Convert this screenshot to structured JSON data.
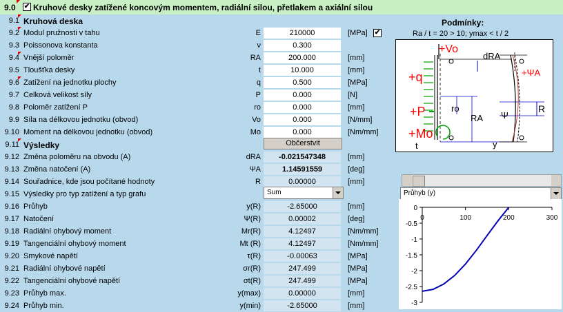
{
  "header": {
    "num": "9.0",
    "title": "Kruhové desky zatížené koncovým momentem, radiální silou, přetlakem a axiální silou",
    "checked": "✔"
  },
  "rows": [
    {
      "n": "9.1",
      "label": "Kruhová deska",
      "sym": "",
      "val": "",
      "unit": ""
    },
    {
      "n": "9.2",
      "label": "Modul pružnosti v tahu",
      "sym": "E",
      "val": "210000",
      "unit": "[MPa]"
    },
    {
      "n": "9.3",
      "label": "Poissonova konstanta",
      "sym": "ν",
      "val": "0.300",
      "unit": ""
    },
    {
      "n": "9.4",
      "label": "Vnější poloměr",
      "sym": "RA",
      "val": "200.000",
      "unit": "[mm]"
    },
    {
      "n": "9.5",
      "label": "Tloušťka desky",
      "sym": "t",
      "val": "10.000",
      "unit": "[mm]"
    },
    {
      "n": "9.6",
      "label": "Zatížení na jednotku plochy",
      "sym": "q",
      "val": "0.500",
      "unit": "[MPa]"
    },
    {
      "n": "9.7",
      "label": "Celková velikost síly",
      "sym": "P",
      "val": "0.000",
      "unit": "[N]"
    },
    {
      "n": "9.8",
      "label": "Poloměr zatížení P",
      "sym": "ro",
      "val": "0.000",
      "unit": "[mm]"
    },
    {
      "n": "9.9",
      "label": "Síla na délkovou jednotku (obvod)",
      "sym": "Vo",
      "val": "0.000",
      "unit": "[N/mm]"
    },
    {
      "n": "9.10",
      "label": "Moment na délkovou jednotku (obvod)",
      "sym": "Mo",
      "val": "0.000",
      "unit": "[Nm/mm]"
    },
    {
      "n": "9.11",
      "label": "Výsledky",
      "sym": "",
      "val": "",
      "unit": ""
    },
    {
      "n": "9.12",
      "label": "Změna poloměru na obvodu (A)",
      "sym": "dRA",
      "val": "-0.021547348",
      "unit": "[mm]"
    },
    {
      "n": "9.13",
      "label": "Změna natočení (A)",
      "sym": "ΨA",
      "val": "1.14591559",
      "unit": "[deg]"
    },
    {
      "n": "9.14",
      "label": "Souřadnice, kde jsou počítané hodnoty",
      "sym": "R",
      "val": "0.00000",
      "unit": "[mm]"
    },
    {
      "n": "9.15",
      "label": "Výsledky pro typ zatížení a typ grafu",
      "sym": "",
      "val": "",
      "unit": ""
    },
    {
      "n": "9.16",
      "label": "Průhyb",
      "sym": "y(R)",
      "val": "-2.65000",
      "unit": "[mm]"
    },
    {
      "n": "9.17",
      "label": "Natočení",
      "sym": "Ψ(R)",
      "val": "0.00002",
      "unit": "[deg]"
    },
    {
      "n": "9.18",
      "label": "Radiální ohybový moment",
      "sym": "Mr(R)",
      "val": "4.12497",
      "unit": "[Nm/mm]"
    },
    {
      "n": "9.19",
      "label": "Tangenciální ohybový moment",
      "sym": "Mt (R)",
      "val": "4.12497",
      "unit": "[Nm/mm]"
    },
    {
      "n": "9.20",
      "label": "Smykové napětí",
      "sym": "τ(R)",
      "val": "-0.00063",
      "unit": "[MPa]"
    },
    {
      "n": "9.21",
      "label": "Radiální ohybové napětí",
      "sym": "σr(R)",
      "val": "247.499",
      "unit": "[MPa]"
    },
    {
      "n": "9.22",
      "label": "Tangenciální ohybové napětí",
      "sym": "σt(R)",
      "val": "247.499",
      "unit": "[MPa]"
    },
    {
      "n": "9.23",
      "label": "Průhyb max.",
      "sym": "y(max)",
      "val": "0.00000",
      "unit": "[mm]"
    },
    {
      "n": "9.24",
      "label": "Průhyb min.",
      "sym": "y(min)",
      "val": "-2.65000",
      "unit": "[mm]"
    }
  ],
  "button": {
    "recalc": "Občerstvit"
  },
  "load_type": {
    "value": "Sum"
  },
  "conditions": {
    "title": "Podmínky:",
    "text": "Ra / t = 20 > 10;  ymax < t / 2"
  },
  "diagram_labels": {
    "vo": "+Vo",
    "q": "+q",
    "p": "+P",
    "mo": "+Mo",
    "dra": "dRA",
    "psia": "+ΨA",
    "ro": "ro",
    "ra": "RA",
    "r": "R",
    "psi": "Ψ",
    "t": "t",
    "y": "y"
  },
  "graph_select": {
    "value": "Průhyb (y)"
  },
  "colors": {
    "bg": "#b8d8ec",
    "header": "#c8f0c4",
    "diagram_red": "#ff0000",
    "diagram_blue": "#0000cc",
    "curve": "#0000b0"
  },
  "chart_data": {
    "type": "line",
    "x": [
      0,
      25,
      50,
      75,
      100,
      125,
      150,
      175,
      200
    ],
    "y": [
      -2.65,
      -2.59,
      -2.42,
      -2.15,
      -1.79,
      -1.36,
      -0.89,
      -0.43,
      0.0
    ],
    "xlim": [
      0,
      300
    ],
    "ylim": [
      -3,
      0
    ],
    "xticks": [
      0,
      100,
      200,
      300
    ],
    "yticks": [
      0,
      -0.5,
      -1,
      -1.5,
      -2,
      -2.5,
      -3
    ],
    "xticklabels": [
      "0",
      "100",
      "200",
      "300"
    ],
    "yticklabels": [
      "0",
      "-0.5",
      "-1",
      "-1.5",
      "-2",
      "-2.5",
      "-3"
    ],
    "title": "",
    "xlabel": "",
    "ylabel": "",
    "x_axis_at": "top",
    "grid": false
  }
}
